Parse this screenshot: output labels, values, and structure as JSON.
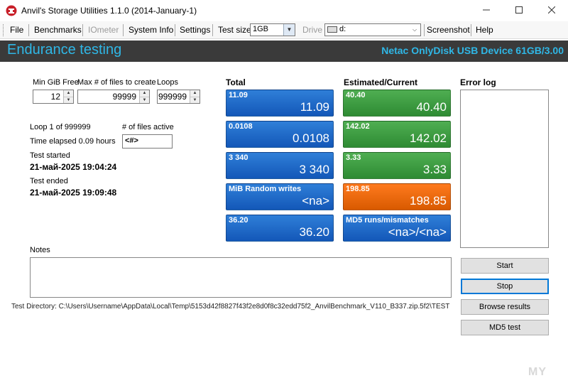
{
  "window": {
    "title": "Anvil's Storage Utilities 1.1.0 (2014-January-1)",
    "minimize": "─",
    "maximize": "☐",
    "close": "✕"
  },
  "menu": {
    "file": "File",
    "benchmarks": "Benchmarks",
    "iometer": "IOmeter",
    "system_info": "System Info",
    "settings": "Settings",
    "test_size_label": "Test size",
    "test_size_value": "1GB",
    "drive_label": "Drive",
    "drive_value": "d:",
    "screenshot": "Screenshot",
    "help": "Help"
  },
  "header": {
    "title": "Endurance testing",
    "device": "Netac OnlyDisk USB Device 61GB/3.00"
  },
  "params": {
    "min_gib_free_label": "Min GiB Free",
    "min_gib_free_value": "12",
    "max_files_label": "Max # of files to create",
    "max_files_value": "99999",
    "loops_label": "Loops",
    "loops_value": "999999"
  },
  "status_info": {
    "loop": "Loop 1 of 999999",
    "files_active_label": "# of files active",
    "files_active_value": "<#>",
    "time_elapsed": "Time elapsed 0.09 hours",
    "test_started_label": "Test started",
    "test_started_value": "21-май-2025 19:04:24",
    "test_ended_label": "Test ended",
    "test_ended_value": "21-май-2025 19:09:48"
  },
  "columns": {
    "total": "Total",
    "estimated": "Estimated/Current",
    "error_log": "Error log"
  },
  "tiles_total": [
    {
      "small": "11.09",
      "large": "11.09",
      "color": "#1f6bcb"
    },
    {
      "small": "0.0108",
      "large": "0.0108",
      "color": "#1f6bcb"
    },
    {
      "small": "3 340",
      "large": "3 340",
      "color": "#1f6bcb"
    },
    {
      "small": "MiB Random writes",
      "large": "<na>",
      "color": "#1f6bcb"
    },
    {
      "small": "36.20",
      "large": "36.20",
      "color": "#1f6bcb"
    }
  ],
  "tiles_estimated": [
    {
      "small": "40.40",
      "large": "40.40",
      "color": "#3a9c3f"
    },
    {
      "small": "142.02",
      "large": "142.02",
      "color": "#3a9c3f"
    },
    {
      "small": "3.33",
      "large": "3.33",
      "color": "#3a9c3f"
    },
    {
      "small": "198.85",
      "large": "198.85",
      "color": "#e86a0c"
    },
    {
      "small": "MD5 runs/mismatches",
      "large": "<na>/<na>",
      "color": "#1f6bcb"
    }
  ],
  "notes_label": "Notes",
  "buttons": {
    "start": "Start",
    "stop": "Stop",
    "browse": "Browse results",
    "md5": "MD5 test"
  },
  "status_line": "Test Directory: C:\\Users\\Username\\AppData\\Local\\Temp\\5153d42f8827f43f2e8d0f8c32edd75f2_AnvilBenchmark_V110_B337.zip.5f2\\TEST",
  "watermark": "MY"
}
